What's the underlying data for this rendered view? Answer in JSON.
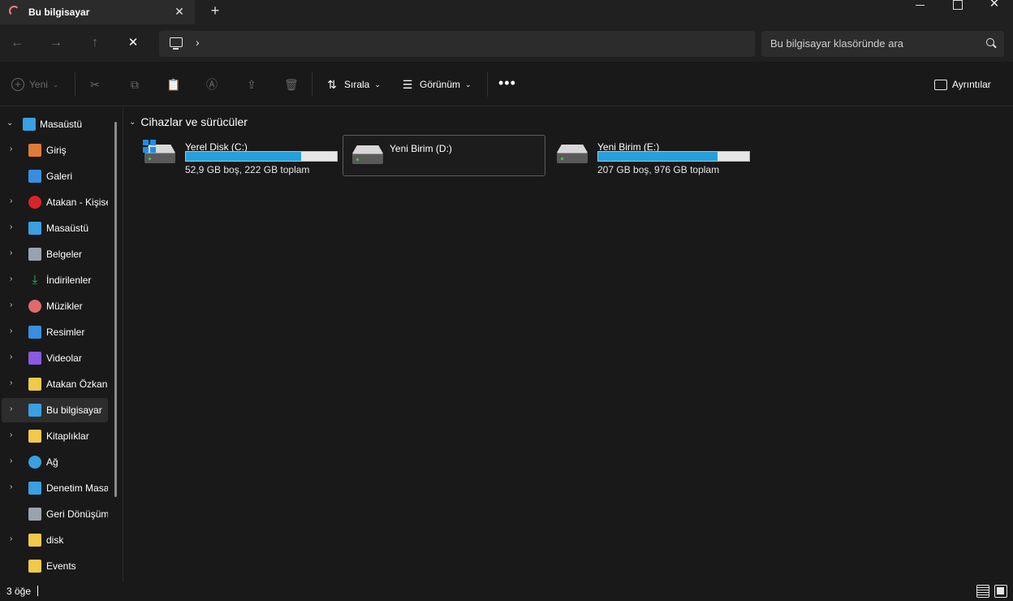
{
  "tab": {
    "title": "Bu bilgisayar",
    "close": "✕",
    "new_tab": "+"
  },
  "window": {
    "close": "✕"
  },
  "nav": {
    "back": "←",
    "forward": "→",
    "up": "↑",
    "stop": "✕",
    "chevron": "›"
  },
  "search": {
    "placeholder": "Bu bilgisayar klasöründe ara"
  },
  "toolbar": {
    "new_label": "Yeni",
    "sort_label": "Sırala",
    "view_label": "Görünüm",
    "more": "•••",
    "details_label": "Ayrıntılar"
  },
  "sidebar": {
    "items": [
      {
        "label": "Masaüstü",
        "icon": "desktop-icon",
        "color": "#3aa0e0"
      },
      {
        "label": "Giriş",
        "icon": "home-icon",
        "color": "#e07a3a"
      },
      {
        "label": "Galeri",
        "icon": "gallery-icon",
        "color": "#3a8ee0"
      },
      {
        "label": "Atakan - Kişise",
        "icon": "onedrive-personal-icon",
        "color": "#d9242b"
      },
      {
        "label": "Masaüstü",
        "icon": "desktop-icon",
        "color": "#3aa0e0"
      },
      {
        "label": "Belgeler",
        "icon": "documents-icon",
        "color": "#9aa3ad"
      },
      {
        "label": "İndirilenler",
        "icon": "downloads-icon",
        "color": "#2fbf71"
      },
      {
        "label": "Müzikler",
        "icon": "music-icon",
        "color": "#e06a6a"
      },
      {
        "label": "Resimler",
        "icon": "pictures-icon",
        "color": "#3a8ee0"
      },
      {
        "label": "Videolar",
        "icon": "videos-icon",
        "color": "#8a5ae0"
      },
      {
        "label": "Atakan Özkan",
        "icon": "folder-icon",
        "color": "#f2c94c"
      },
      {
        "label": "Bu bilgisayar",
        "icon": "this-pc-icon",
        "color": "#3aa0e0"
      },
      {
        "label": "Kitaplıklar",
        "icon": "libraries-icon",
        "color": "#f2c94c"
      },
      {
        "label": "Ağ",
        "icon": "network-icon",
        "color": "#3aa0e0"
      },
      {
        "label": "Denetim Masa",
        "icon": "control-panel-icon",
        "color": "#3aa0e0"
      },
      {
        "label": "Geri Dönüşüm",
        "icon": "recycle-bin-icon",
        "color": "#9aa3ad"
      },
      {
        "label": "disk",
        "icon": "folder-icon",
        "color": "#f2c94c"
      },
      {
        "label": "Events",
        "icon": "folder-icon",
        "color": "#f2c94c"
      }
    ]
  },
  "main": {
    "group_title": "Cihazlar ve sürücüler",
    "drives": [
      {
        "name": "Yerel Disk (C:)",
        "info": "52,9 GB boş, 222 GB toplam",
        "used_fraction": 0.762
      },
      {
        "name": "Yeni Birim (D:)"
      },
      {
        "name": "Yeni Birim (E:)",
        "info": "207 GB boş, 976 GB toplam",
        "used_fraction": 0.788
      }
    ]
  },
  "status": {
    "item_count": "3 öğe"
  },
  "colors": {
    "accent": "#26a0da",
    "background": "#191919"
  }
}
